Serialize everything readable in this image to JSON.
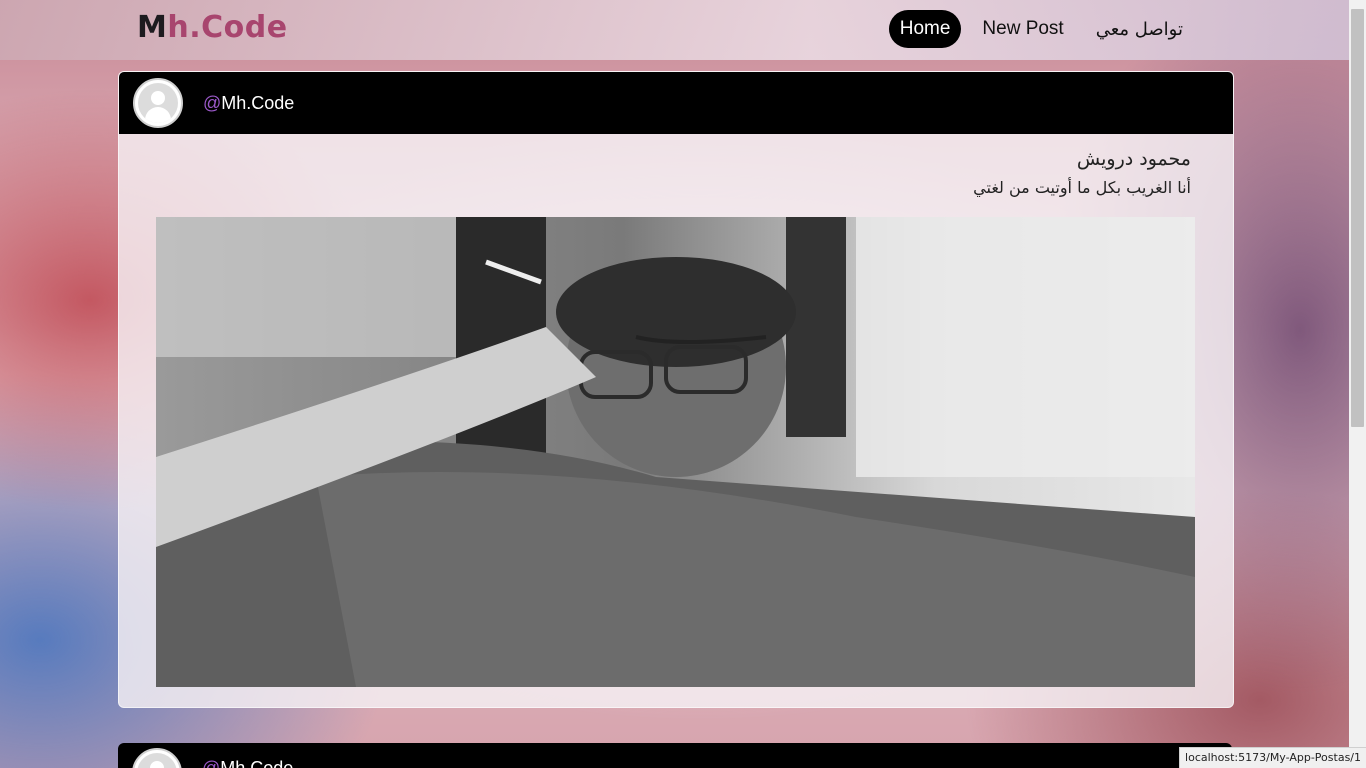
{
  "navbar": {
    "brand_first": "M",
    "brand_rest": "h.Code",
    "links": [
      {
        "label": "Home",
        "active": true
      },
      {
        "label": "New Post",
        "active": false
      },
      {
        "label": "تواصل معي",
        "active": false
      }
    ]
  },
  "posts": [
    {
      "username": "Mh.Code",
      "title": "محمود درويش",
      "text": "أنا الغريب بكل ما أوتيت من لغتي"
    },
    {
      "username": "Mh.Code"
    }
  ],
  "status_bar": {
    "url": "localhost:5173/My-App-Postas/1"
  },
  "colors": {
    "brand_accent": "#a8456e",
    "username_at": "#9b59c9",
    "active_nav_bg": "#000000"
  }
}
